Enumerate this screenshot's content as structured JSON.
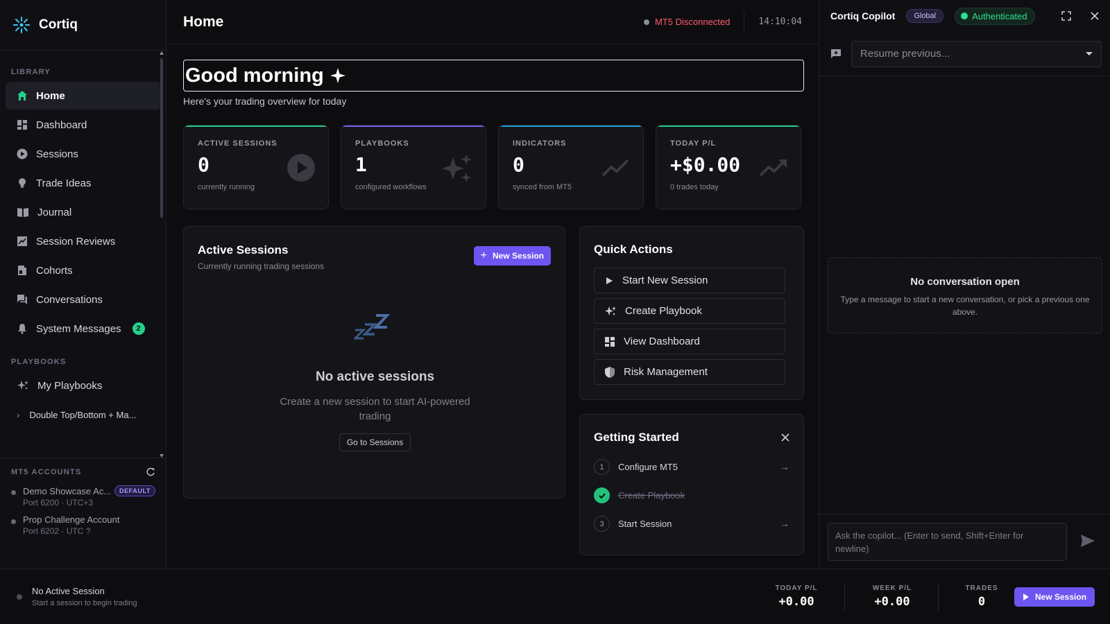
{
  "app": {
    "name": "Cortiq"
  },
  "sidebar": {
    "library_label": "LIBRARY",
    "items": [
      {
        "label": "Home",
        "icon": "home-icon"
      },
      {
        "label": "Dashboard",
        "icon": "dashboard-icon"
      },
      {
        "label": "Sessions",
        "icon": "play-circle-icon"
      },
      {
        "label": "Trade Ideas",
        "icon": "lightbulb-icon"
      },
      {
        "label": "Journal",
        "icon": "book-icon"
      },
      {
        "label": "Session Reviews",
        "icon": "chart-review-icon"
      },
      {
        "label": "Cohorts",
        "icon": "cohorts-icon"
      },
      {
        "label": "Conversations",
        "icon": "chat-icon"
      },
      {
        "label": "System Messages",
        "icon": "bell-icon",
        "badge": "2"
      }
    ],
    "playbooks_label": "PLAYBOOKS",
    "my_playbooks": "My Playbooks",
    "playbook_items": [
      "Double Top/Bottom + Ma..."
    ],
    "mt5_label": "MT5 ACCOUNTS",
    "accounts": [
      {
        "name": "Demo Showcase Ac...",
        "sub": "Port 6200 · UTC+3",
        "badge": "DEFAULT"
      },
      {
        "name": "Prop Challenge Account",
        "sub": "Port 6202 · UTC ?"
      }
    ]
  },
  "header": {
    "title": "Home",
    "status": "MT5 Disconnected",
    "clock": "14:10:04"
  },
  "main": {
    "greeting": "Good morning",
    "subtitle": "Here's your trading overview for today",
    "stats": [
      {
        "label": "ACTIVE SESSIONS",
        "value": "0",
        "sub": "currently running",
        "color": "#1fc98a",
        "icon": "play-circle-icon"
      },
      {
        "label": "PLAYBOOKS",
        "value": "1",
        "sub": "configured workflows",
        "color": "#7c5cf0",
        "icon": "sparkles-icon"
      },
      {
        "label": "INDICATORS",
        "value": "0",
        "sub": "synced from MT5",
        "color": "#1f9fd6",
        "icon": "trend-line-icon"
      },
      {
        "label": "TODAY P/L",
        "value": "+$0.00",
        "sub": "0 trades today",
        "color": "#1fc98a",
        "icon": "trending-up-icon"
      }
    ],
    "active_sessions": {
      "title": "Active Sessions",
      "subtitle": "Currently running trading sessions",
      "new_button": "New Session",
      "empty_title": "No active sessions",
      "empty_sub": "Create a new session to start AI-powered trading",
      "goto_button": "Go to Sessions"
    },
    "quick_actions": {
      "title": "Quick Actions",
      "items": [
        "Start New Session",
        "Create Playbook",
        "View Dashboard",
        "Risk Management"
      ]
    },
    "getting_started": {
      "title": "Getting Started",
      "steps": [
        {
          "num": "1",
          "label": "Configure MT5",
          "done": false
        },
        {
          "num": "2",
          "label": "Create Playbook",
          "done": true
        },
        {
          "num": "3",
          "label": "Start Session",
          "done": false
        }
      ]
    }
  },
  "copilot": {
    "title": "Cortiq Copilot",
    "scope": "Global",
    "auth": "Authenticated",
    "resume_placeholder": "Resume previous...",
    "empty_title": "No conversation open",
    "empty_sub": "Type a message to start a new conversation, or pick a previous one above.",
    "input_placeholder": "Ask the copilot... (Enter to send, Shift+Enter for newline)"
  },
  "bottombar": {
    "session_title": "No Active Session",
    "session_sub": "Start a session to begin trading",
    "today_label": "TODAY P/L",
    "today_value": "+0.00",
    "week_label": "WEEK P/L",
    "week_value": "+0.00",
    "trades_label": "TRADES",
    "trades_value": "0",
    "new_button": "New Session"
  },
  "colors": {
    "accent": "#6d56f0",
    "success": "#23d18b",
    "danger": "#ff5c6c"
  }
}
